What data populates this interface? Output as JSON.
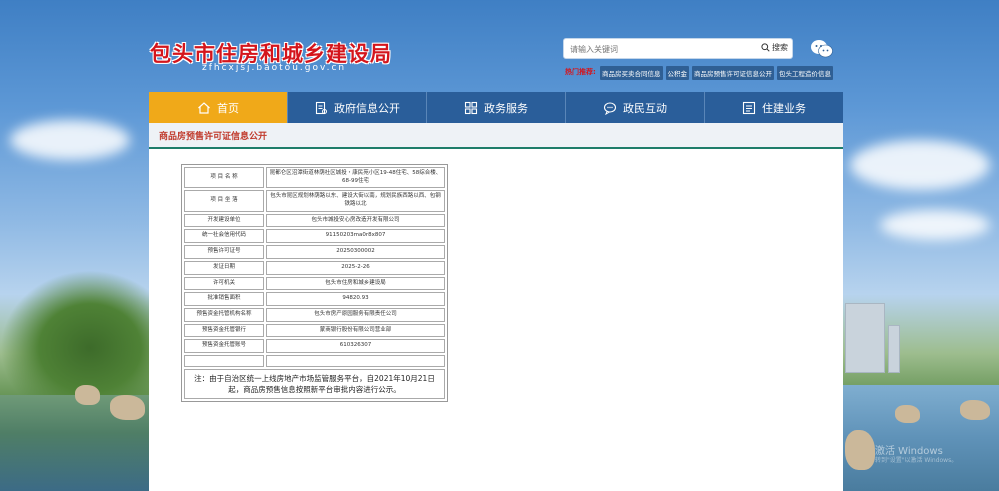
{
  "header": {
    "title": "包头市住房和城乡建设局",
    "domain": "zfhcxjsj.baotou.gov.cn"
  },
  "search": {
    "placeholder": "请输入关键词",
    "button_label": "搜索"
  },
  "hot": {
    "label": "热门推荐:",
    "links": [
      "商品房买卖合同信息",
      "公积金",
      "商品房预售许可证信息公开",
      "包头工程造价信息"
    ]
  },
  "nav": {
    "items": [
      {
        "label": "首页",
        "icon": "home-icon",
        "active": true
      },
      {
        "label": "政府信息公开",
        "icon": "document-icon",
        "active": false
      },
      {
        "label": "政务服务",
        "icon": "grid-icon",
        "active": false
      },
      {
        "label": "政民互动",
        "icon": "chat-icon",
        "active": false
      },
      {
        "label": "住建业务",
        "icon": "list-icon",
        "active": false
      }
    ]
  },
  "section": {
    "title": "商品房预售许可证信息公开"
  },
  "permit": {
    "rows": [
      {
        "label": "项 目 名 称",
        "value": "昆都仑区沼潭街道林荫社区城投・康民苑小区19-48住宅、58综合楼、68-99住宅"
      },
      {
        "label": "项 目 坐 落",
        "value": "包头市昆区规划林荫路以东、建设大街以南，规划民族西路以西、包钢铁路以北"
      },
      {
        "label": "开发建设单位",
        "value": "包头市城投安心房改造开发有限公司"
      },
      {
        "label": "统一社会信用代码",
        "value": "91150203ma0r8x807"
      },
      {
        "label": "预售许可证号",
        "value": "20250300002"
      },
      {
        "label": "发证日期",
        "value": "2025-2-26"
      },
      {
        "label": "许可机关",
        "value": "包头市住房和城乡建设局"
      },
      {
        "label": "批准销售面积",
        "value": "94820.93"
      },
      {
        "label": "预售资金托管机构名称",
        "value": "包头市房产原园服务有限责任公司"
      },
      {
        "label": "预售资金托管银行",
        "value": "蒙商银行股份有限公司营业部"
      },
      {
        "label": "预售资金托管账号",
        "value": "610326307"
      },
      {
        "label": "",
        "value": ""
      }
    ],
    "note": "注：由于自治区统一上线房地产市场监管服务平台，自2021年10月21日起，商品房预售信息按照新平台审批内容进行公示。"
  },
  "os_watermark": {
    "line1": "激活 Windows",
    "line2": "转到\"设置\"以激活 Windows。"
  },
  "colors": {
    "brand_red": "#d4151c",
    "nav_blue": "#2a5e9a",
    "nav_active": "#f0a919",
    "section_line": "#1e7d6a"
  }
}
